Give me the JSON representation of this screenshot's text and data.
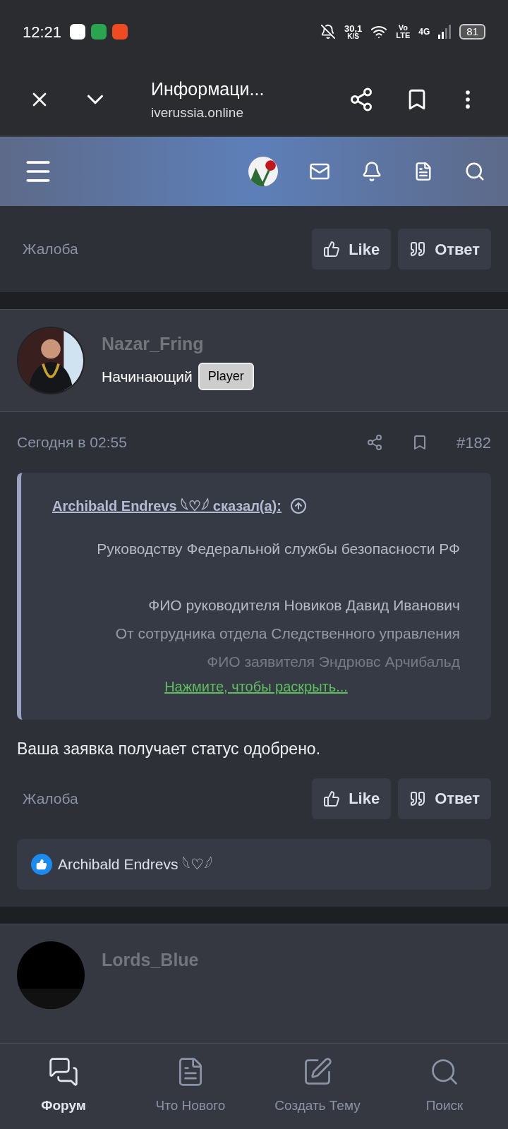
{
  "status_bar": {
    "time": "12:21",
    "speed": "30,1",
    "speed_unit": "K/S",
    "volte_top": "Vo",
    "volte_bottom": "LTE",
    "network": "4G",
    "battery": "81"
  },
  "browser": {
    "title": "Информаци...",
    "url": "iverussia.online"
  },
  "previous_post": {
    "report": "Жалоба",
    "like": "Like",
    "reply": "Ответ"
  },
  "post": {
    "author": "Nazar_Fring",
    "rank": "Начинающий",
    "badge": "Player",
    "date": "Сегодня в 02:55",
    "number": "#182",
    "quote": {
      "attribution": "Archibald Endrevs 𓆩♡𓆪 сказал(а):",
      "lines": [
        "Руководству Федеральной службы безопасности РФ",
        "ФИО руководителя Новиков Давид Иванович",
        "От сотрудника отдела Следственного управления",
        "ФИО заявителя Эндрювс Арчибальд"
      ],
      "expand": "Нажмите, чтобы раскрыть..."
    },
    "body": "Ваша заявка получает статус одобрено.",
    "report": "Жалоба",
    "like": "Like",
    "reply": "Ответ",
    "reactions": "Archibald Endrevs 𓆩♡𓆪"
  },
  "next_post": {
    "author": "Lords_Blue"
  },
  "bottom_nav": [
    {
      "label": "Форум",
      "kind": "forum",
      "selected": true
    },
    {
      "label": "Что Нового",
      "kind": "news",
      "selected": false
    },
    {
      "label": "Создать Тему",
      "kind": "create",
      "selected": false
    },
    {
      "label": "Поиск",
      "kind": "search",
      "selected": false
    }
  ]
}
